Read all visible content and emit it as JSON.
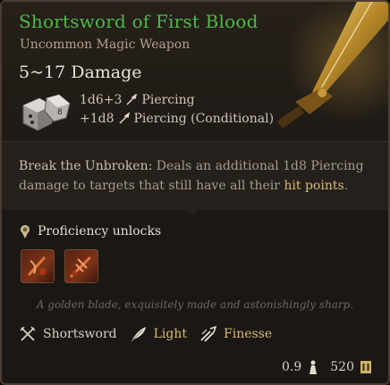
{
  "item": {
    "name": "Shortsword of First Blood",
    "subtitle": "Uncommon Magic Weapon",
    "damage": "5~17 Damage",
    "damage_lines": [
      {
        "dice": "1d6+3",
        "type": "Piercing"
      },
      {
        "dice": "+1d8",
        "type": "Piercing (Conditional)"
      }
    ],
    "effect": {
      "name": "Break the Unbroken:",
      "text_before": "Deals an additional 1d8 Piercing damage to targets that still have all their",
      "highlight": "hit points",
      "text_after": "."
    },
    "proficiency_label": "Proficiency unlocks",
    "flavor": "A golden blade, exquisitely made and astonishingly sharp.",
    "properties": [
      {
        "label": "Shortsword",
        "color": "#d8d0c4",
        "icon": "crossed-swords-icon"
      },
      {
        "label": "Light",
        "color": "#d8bd6e",
        "icon": "feather-icon"
      },
      {
        "label": "Finesse",
        "color": "#d8bd6e",
        "icon": "finesse-icon"
      }
    ],
    "weight": "0.9",
    "value": "520"
  },
  "colors": {
    "name": "#4fb84a",
    "subtitle": "#b6a188",
    "highlight": "#d8bd6e",
    "background": "#1b1714"
  }
}
